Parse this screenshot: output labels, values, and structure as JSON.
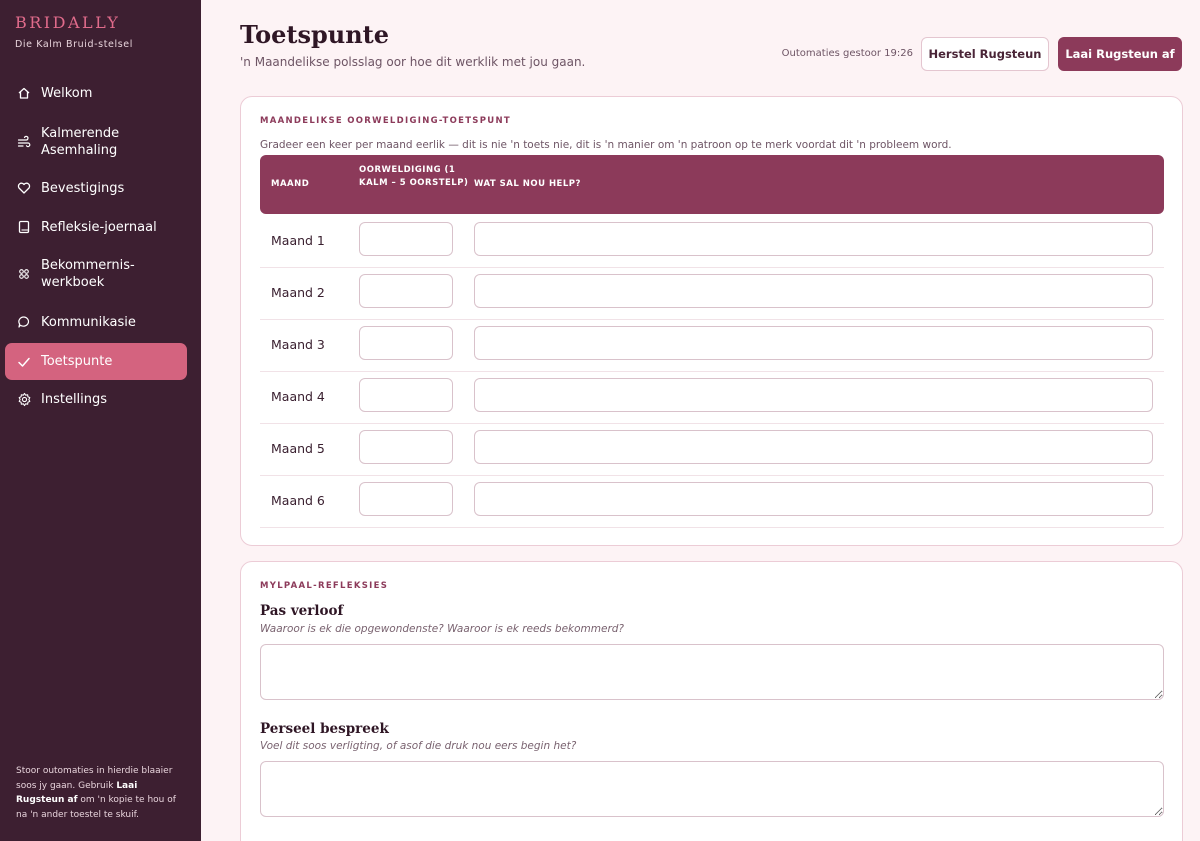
{
  "sidebar": {
    "brand": "BRIDALLY",
    "tagline": "Die Kalm Bruid-stelsel",
    "items": [
      {
        "label": "Welkom",
        "icon": "home-icon"
      },
      {
        "label": "Kalmerende Asemhaling",
        "icon": "wind-icon"
      },
      {
        "label": "Bevestigings",
        "icon": "heart-icon"
      },
      {
        "label": "Refleksie-joernaal",
        "icon": "book-icon"
      },
      {
        "label": "Bekommernis-werkboek",
        "icon": "puzzle-icon"
      },
      {
        "label": "Kommunikasie",
        "icon": "chat-icon"
      },
      {
        "label": "Toetspunte",
        "icon": "check-icon",
        "active": true
      },
      {
        "label": "Instellings",
        "icon": "gear-icon"
      }
    ],
    "note_1": "Stoor outomaties in hierdie blaaier soos jy gaan. Gebruik ",
    "note_bold": "Laai Rugsteun af",
    "note_2": " om 'n kopie te hou of na 'n ander toestel te skuif."
  },
  "header": {
    "title": "Toetspunte",
    "subtitle": "'n Maandelikse polsslag oor hoe dit werklik met jou gaan.",
    "autosave": "Outomaties gestoor 19:26",
    "restore_label": "Herstel Rugsteun",
    "download_label": "Laai Rugsteun af"
  },
  "overwhelm": {
    "label": "MAANDELIKSE OORWELDIGING-TOETSPUNT",
    "description": "Gradeer een keer per maand eerlik — dit is nie 'n toets nie, dit is 'n manier om 'n patroon op te merk voordat dit 'n probleem word.",
    "columns": [
      "MAAND",
      "OORWELDIGING (1 KALM – 5 OORSTELP)",
      "WAT SAL NOU HELP?"
    ],
    "rows": [
      {
        "month": "Maand 1",
        "score": "",
        "help": ""
      },
      {
        "month": "Maand 2",
        "score": "",
        "help": ""
      },
      {
        "month": "Maand 3",
        "score": "",
        "help": ""
      },
      {
        "month": "Maand 4",
        "score": "",
        "help": ""
      },
      {
        "month": "Maand 5",
        "score": "",
        "help": ""
      },
      {
        "month": "Maand 6",
        "score": "",
        "help": ""
      }
    ]
  },
  "milestones": {
    "label": "MYLPAAL-REFLEKSIES",
    "items": [
      {
        "title": "Pas verloof",
        "prompt": "Waaroor is ek die opgewondenste? Waaroor is ek reeds bekommerd?",
        "value": ""
      },
      {
        "title": "Perseel bespreek",
        "prompt": "Voel dit soos verligting, of asof die druk nou eers begin het?",
        "value": ""
      }
    ]
  },
  "colors": {
    "sidebar_bg": "#3d1f31",
    "accent": "#8c3a5a",
    "active_nav": "#d4637f",
    "brand": "#e06b8b",
    "page_bg": "#fdf3f5"
  }
}
